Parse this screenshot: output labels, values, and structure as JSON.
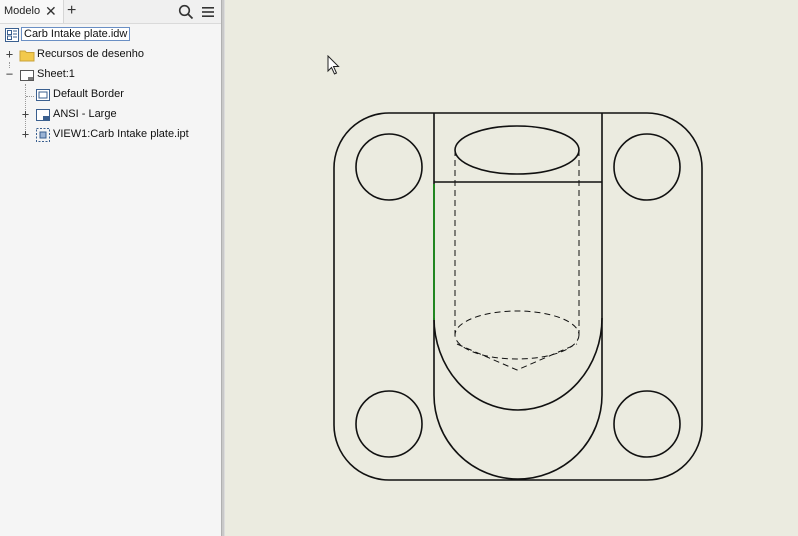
{
  "browser": {
    "tab_label": "Modelo",
    "tree": [
      {
        "label": "Carb Intake plate.idw"
      },
      {
        "label": "Recursos de desenho"
      },
      {
        "label": "Sheet:1"
      },
      {
        "label": "Default Border"
      },
      {
        "label": "ANSI - Large"
      },
      {
        "label": "VIEW1:Carb Intake plate.ipt"
      }
    ]
  },
  "colors": {
    "canvas_bg": "#ebebe0",
    "line": "#111111",
    "highlight_edge": "#1a8a1a"
  }
}
